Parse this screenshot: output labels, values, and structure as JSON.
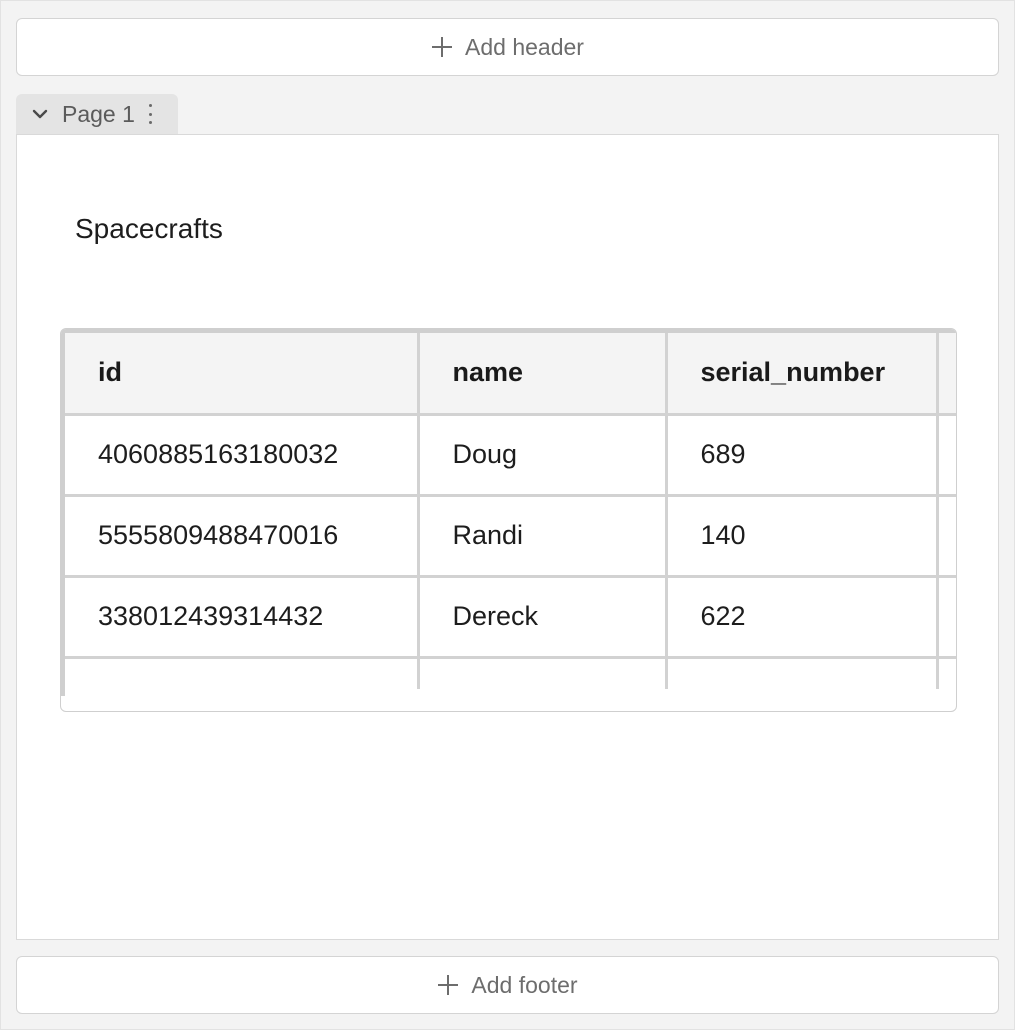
{
  "header_bar": {
    "label": "Add header",
    "icon": "plus-icon"
  },
  "footer_bar": {
    "label": "Add footer",
    "icon": "plus-icon"
  },
  "page_tab": {
    "label": "Page 1",
    "expand_icon": "chevron-down-icon",
    "menu_icon": "kebab-icon"
  },
  "page": {
    "title": "Spacecrafts",
    "table": {
      "columns": [
        "id",
        "name",
        "serial_number",
        ""
      ],
      "rows": [
        [
          "4060885163180032",
          "Doug",
          "689",
          ""
        ],
        [
          "5555809488470016",
          "Randi",
          "140",
          ""
        ],
        [
          "338012439314432",
          "Dereck",
          "622",
          ""
        ]
      ]
    }
  },
  "colors": {
    "background": "#f3f3f3",
    "panel": "#ffffff",
    "tab": "#e4e4e4",
    "grid_line": "#d2d2d2",
    "header_cell": "#f4f4f4",
    "muted_text": "#6d6d6d"
  }
}
